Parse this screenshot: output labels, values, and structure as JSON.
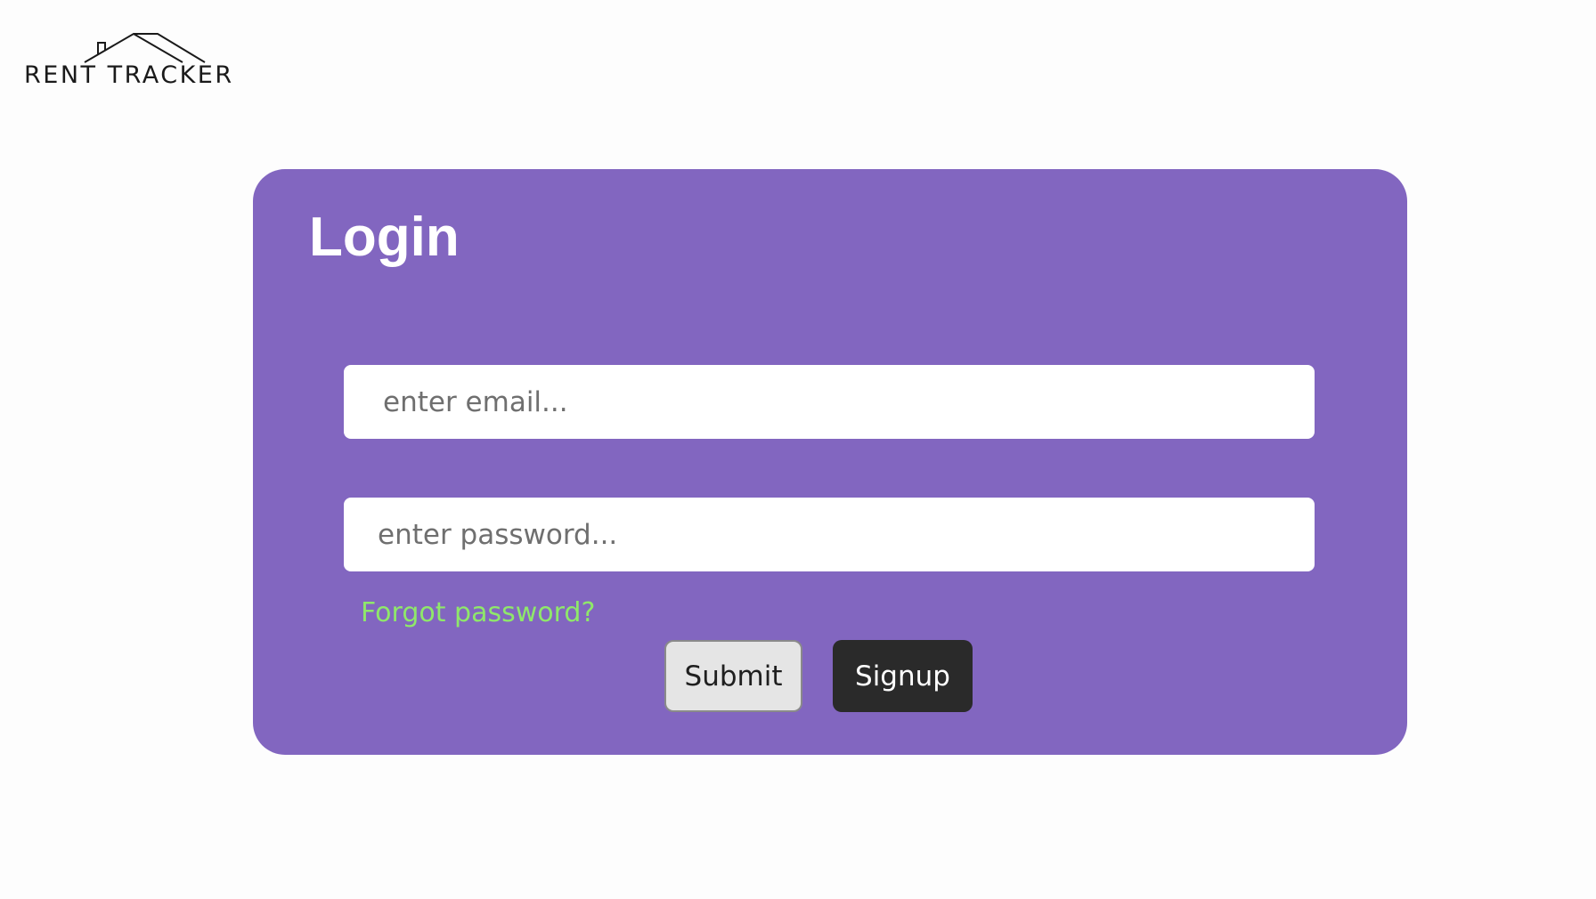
{
  "logo": {
    "text": "RENT TRACKER",
    "icon": "house-roof-icon"
  },
  "login": {
    "title": "Login",
    "email_placeholder": "enter email...",
    "password_placeholder": "enter password...",
    "forgot_label": "Forgot password?",
    "submit_label": "Submit",
    "signup_label": "Signup"
  },
  "colors": {
    "card": "#8266c0",
    "link": "#8fe86a",
    "signup_button": "#2a2a2a",
    "submit_button": "#e5e5e5",
    "background": "#fdfdfd"
  }
}
